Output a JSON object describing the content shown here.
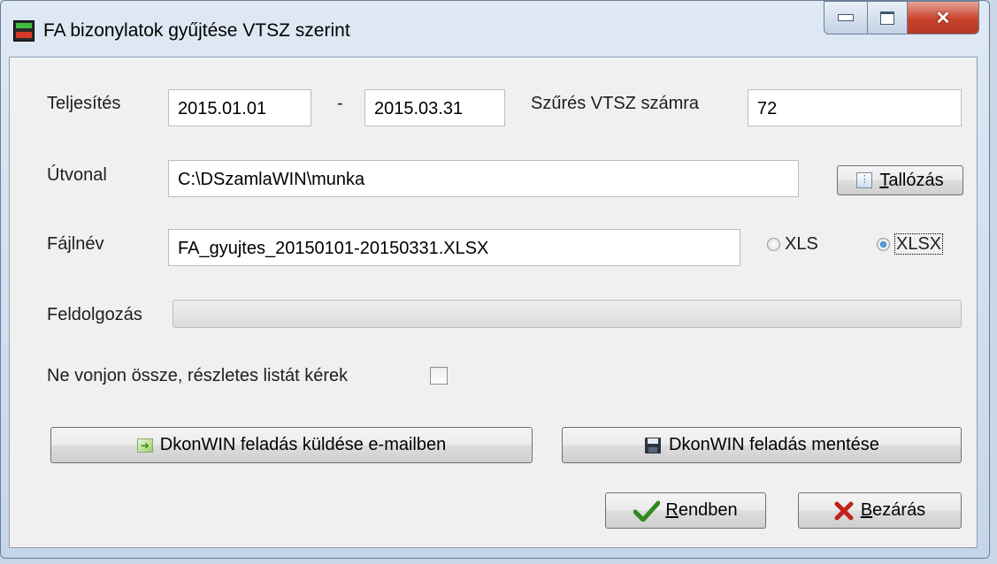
{
  "window": {
    "title": "FA bizonylatok gyűjtése VTSZ szerint"
  },
  "form": {
    "teljesites_label": "Teljesítés",
    "date_from": "2015.01.01",
    "date_sep": "-",
    "date_to": "2015.03.31",
    "vtsz_label": "Szűrés VTSZ számra",
    "vtsz_value": "72",
    "path_label": "Útvonal",
    "path_value": "C:\\DSzamlaWIN\\munka",
    "browse_label": "Tallózás",
    "filename_label": "Fájlnév",
    "filename_value": "FA_gyujtes_20150101-20150331.XLSX",
    "format_options": [
      {
        "label": "XLS",
        "selected": false
      },
      {
        "label": "XLSX",
        "selected": true
      }
    ],
    "progress_label": "Feldolgozás",
    "progress_value": 0,
    "detail_label": "Ne vonjon össze, részletes listát kérek",
    "detail_checked": false,
    "email_button_label": "DkonWIN feladás küldése e-mailben",
    "save_button_label": "DkonWIN feladás mentése",
    "ok_button_label": "Rendben",
    "close_button_label": "Bezárás"
  },
  "colors": {
    "ok_check": "#2e8b1e",
    "close_x": "#c0231b",
    "progress_fill": "#2eb84a"
  }
}
